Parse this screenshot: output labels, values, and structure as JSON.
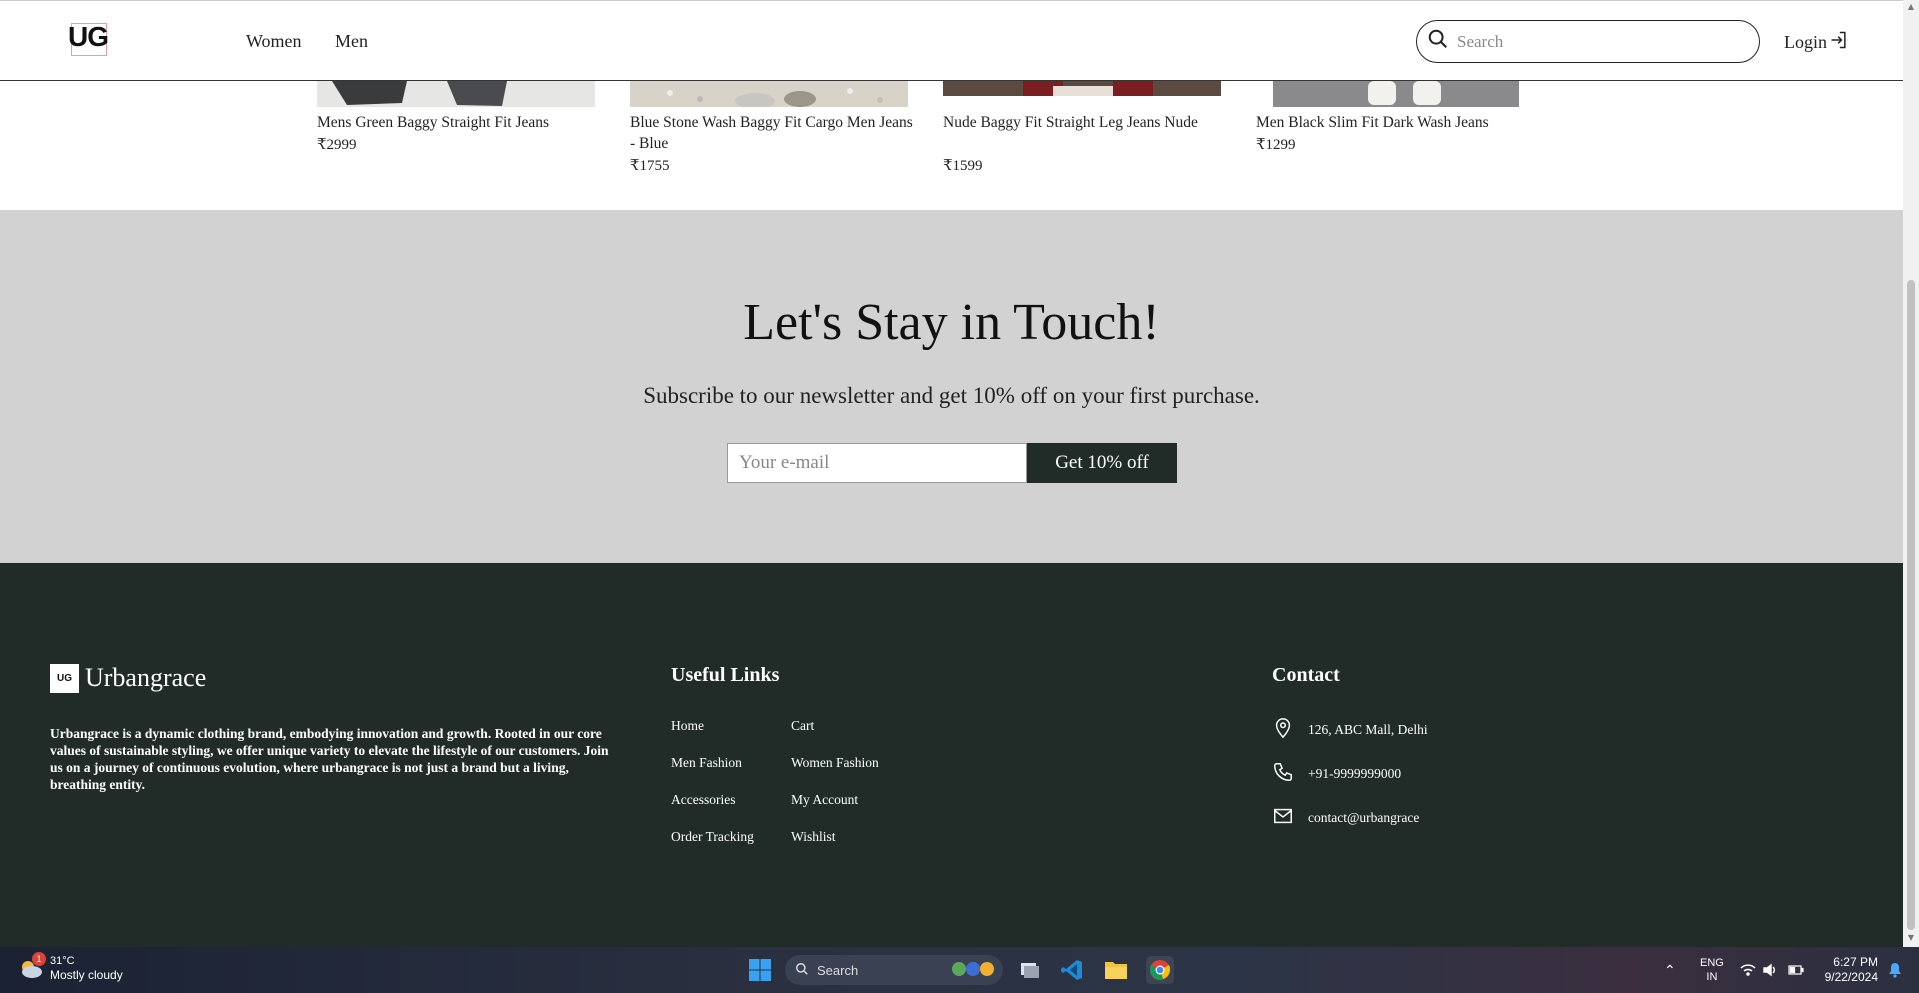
{
  "header": {
    "logo_text": "UG",
    "nav": [
      "Women",
      "Men"
    ],
    "search_placeholder": "Search",
    "login_label": "Login"
  },
  "products": [
    {
      "name": "Mens Green Baggy Straight Fit Jeans",
      "price": "₹2999"
    },
    {
      "name": "Blue Stone Wash Baggy Fit Cargo Men Jeans - Blue",
      "price": "₹1755"
    },
    {
      "name": "Nude Baggy Fit Straight Leg Jeans Nude",
      "price": "₹1599"
    },
    {
      "name": "Men Black Slim Fit Dark Wash Jeans",
      "price": "₹1299"
    }
  ],
  "newsletter": {
    "heading": "Let's Stay in Touch!",
    "subtext": "Subscribe to our newsletter and get 10% off on your first purchase.",
    "email_placeholder": "Your e-mail",
    "button_label": "Get 10% off"
  },
  "footer": {
    "brand_mark": "UG",
    "brand_name": "Urbangrace",
    "about": "Urbangrace is a dynamic clothing brand, embodying innovation and growth. Rooted in our core values of sustainable styling, we offer unique variety to elevate the lifestyle of our customers. Join us on a journey of continuous evolution, where urbangrace is not just a brand but a living, breathing entity.",
    "useful_links_heading": "Useful Links",
    "links_col1": [
      "Home",
      "Men Fashion",
      "Accessories",
      "Order Tracking"
    ],
    "links_col2": [
      "Cart",
      "Women Fashion",
      "My Account",
      "Wishlist"
    ],
    "contact_heading": "Contact",
    "contact": {
      "address": "126, ABC Mall, Delhi",
      "phone": "+91-9999999000",
      "email": "contact@urbangrace"
    }
  },
  "taskbar": {
    "weather_temp": "31°C",
    "weather_desc": "Mostly cloudy",
    "weather_badge": "1",
    "search_label": "Search",
    "lang_top": "ENG",
    "lang_bottom": "IN",
    "time": "6:27 PM",
    "date": "9/22/2024"
  },
  "colors": {
    "footer_bg": "#212c28",
    "newsletter_bg": "#d2d2d2",
    "button_bg": "#212c28"
  }
}
